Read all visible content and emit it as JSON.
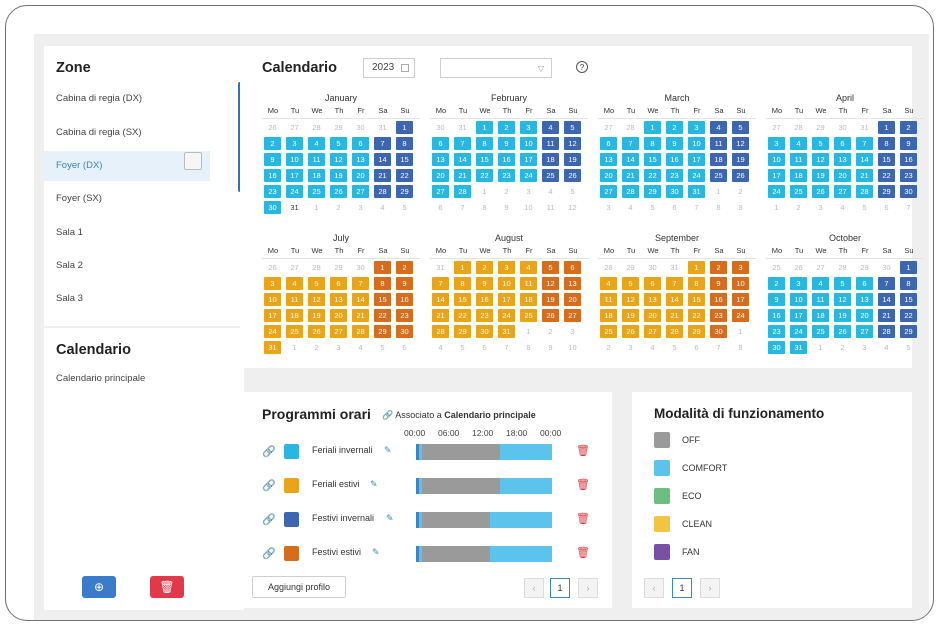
{
  "zones_title": "Zone",
  "zones": [
    "Cabina di regia (DX)",
    "Cabina di regia (SX)",
    "Foyer (DX)",
    "Foyer (SX)",
    "Sala 1",
    "Sala 2",
    "Sala 3"
  ],
  "selected_zone_index": 2,
  "calendars_title": "Calendario",
  "calendars": [
    "Calendario principale"
  ],
  "calendar": {
    "title": "Calendario",
    "year": "2023",
    "weekdays": [
      "Mo",
      "Tu",
      "We",
      "Th",
      "Fr",
      "Sa",
      "Su"
    ],
    "months": [
      "January",
      "February",
      "March",
      "April",
      "July",
      "August",
      "September",
      "October"
    ]
  },
  "schedules": {
    "title": "Programmi orari",
    "associated_prefix": "Associato a",
    "associated_calendar": "Calendario principale",
    "hours": [
      "00:00",
      "06:00",
      "12:00",
      "18:00",
      "00:00"
    ],
    "items": [
      {
        "label": "Feriali invernali",
        "color": "#27b7e0"
      },
      {
        "label": "Feriali estivi",
        "color": "#eaa41a"
      },
      {
        "label": "Festivi invernali",
        "color": "#3c67b0"
      },
      {
        "label": "Festivi estivi",
        "color": "#d86c1d"
      }
    ],
    "add_label": "Aggiungi profilo",
    "page": "1"
  },
  "modes": {
    "title": "Modalità di funzionamento",
    "items": [
      {
        "label": "OFF",
        "color": "#9a9a9a"
      },
      {
        "label": "COMFORT",
        "color": "#5bc3ec"
      },
      {
        "label": "ECO",
        "color": "#6dbf80"
      },
      {
        "label": "CLEAN",
        "color": "#f2c440"
      },
      {
        "label": "FAN",
        "color": "#7a4fa6"
      }
    ],
    "page": "1"
  },
  "colors": {
    "accent": "#3a87c4",
    "add_button": "#3a7cc9",
    "delete_button": "#e03a4a"
  }
}
